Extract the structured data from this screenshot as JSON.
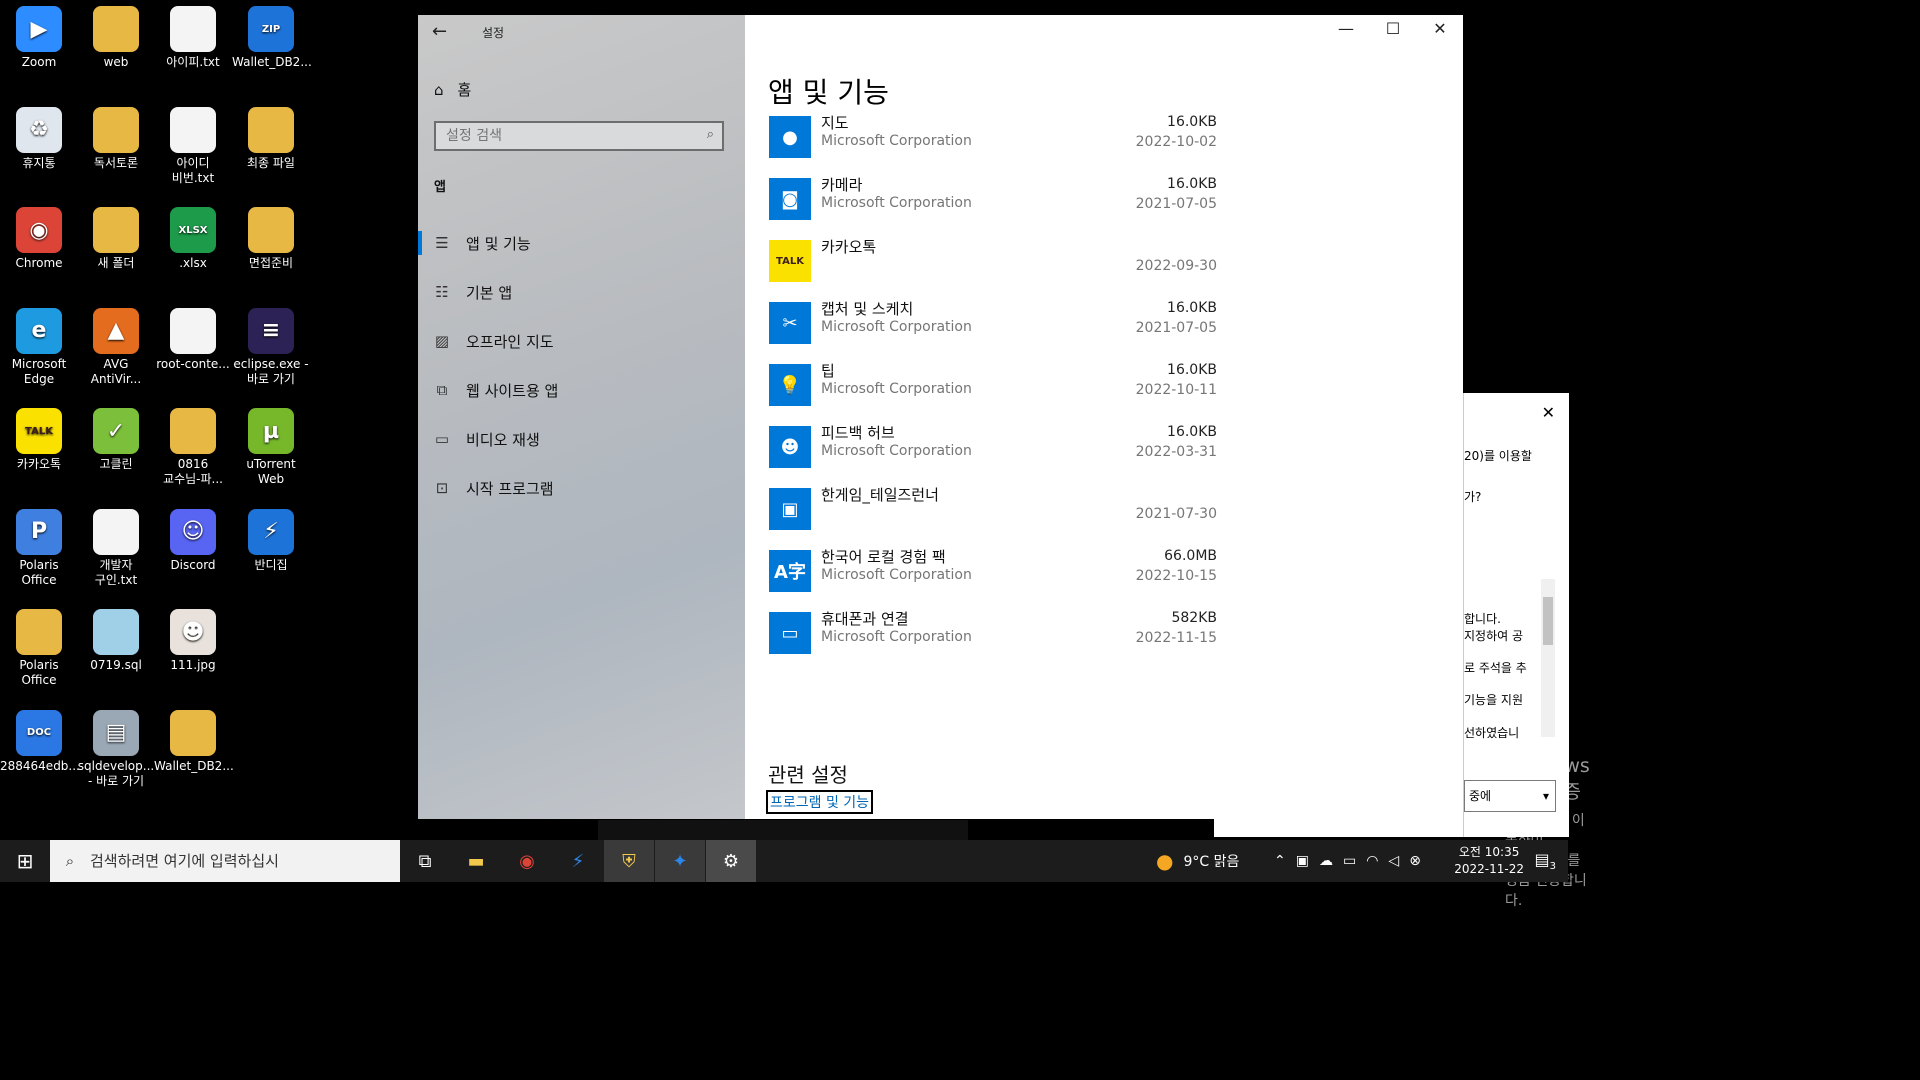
{
  "desktop": {
    "icons": [
      {
        "label": "Zoom",
        "icon": "zoom-icon",
        "color": "#2d8cff",
        "glyph": "▶"
      },
      {
        "label": "web",
        "icon": "folder-icon",
        "color": "#e8b844",
        "glyph": ""
      },
      {
        "label": "아이피.txt",
        "icon": "text-file-icon",
        "color": "#f4f4f4",
        "glyph": ""
      },
      {
        "label": "Wallet_DB2...",
        "icon": "zip-icon",
        "color": "#1e73d8",
        "glyph": "ZIP"
      },
      {
        "label": "휴지통",
        "icon": "recycle-bin-icon",
        "color": "#dfe6ee",
        "glyph": "♻"
      },
      {
        "label": "독서토론",
        "icon": "folder-icon",
        "color": "#e8b844",
        "glyph": ""
      },
      {
        "label": "아이디\n비번.txt",
        "icon": "text-file-icon",
        "color": "#f4f4f4",
        "glyph": ""
      },
      {
        "label": "최종 파일",
        "icon": "folder-icon",
        "color": "#e8b844",
        "glyph": ""
      },
      {
        "label": "Chrome",
        "icon": "chrome-icon",
        "color": "#db4437",
        "glyph": "◉"
      },
      {
        "label": "새 폴더",
        "icon": "folder-icon",
        "color": "#e8b844",
        "glyph": ""
      },
      {
        "label": ".xlsx",
        "icon": "excel-file-icon",
        "color": "#1d9a4a",
        "glyph": "XLSX"
      },
      {
        "label": "면접준비",
        "icon": "folder-icon",
        "color": "#e8b844",
        "glyph": ""
      },
      {
        "label": "Microsoft\nEdge",
        "icon": "edge-icon",
        "color": "#1e9be0",
        "glyph": "e"
      },
      {
        "label": "AVG\nAntiVir...",
        "icon": "avg-icon",
        "color": "#e46c1e",
        "glyph": "▲"
      },
      {
        "label": "root-conte...",
        "icon": "text-file-icon",
        "color": "#f4f4f4",
        "glyph": ""
      },
      {
        "label": "eclipse.exe -\n바로 가기",
        "icon": "eclipse-icon",
        "color": "#2c2255",
        "glyph": "≡"
      },
      {
        "label": "카카오톡",
        "icon": "kakaotalk-icon",
        "color": "#fae100",
        "glyph": "TALK"
      },
      {
        "label": "고클린",
        "icon": "goclean-icon",
        "color": "#7bbf3a",
        "glyph": "✓"
      },
      {
        "label": "0816\n교수님-파...",
        "icon": "folder-icon",
        "color": "#e8b844",
        "glyph": ""
      },
      {
        "label": "uTorrent\nWeb",
        "icon": "utorrent-icon",
        "color": "#76b82a",
        "glyph": "µ"
      },
      {
        "label": "Polaris Office",
        "icon": "polaris-office-icon",
        "color": "#3f7fe0",
        "glyph": "P"
      },
      {
        "label": "개발자\n구인.txt",
        "icon": "text-file-icon",
        "color": "#f4f4f4",
        "glyph": ""
      },
      {
        "label": "Discord",
        "icon": "discord-icon",
        "color": "#5865f2",
        "glyph": "☺"
      },
      {
        "label": "반디집",
        "icon": "bandizip-icon",
        "color": "#1e73d8",
        "glyph": "⚡"
      },
      {
        "label": "Polaris Office",
        "icon": "folder-icon",
        "color": "#e8b844",
        "glyph": ""
      },
      {
        "label": "0719.sql",
        "icon": "sql-file-icon",
        "color": "#9fd0e8",
        "glyph": ""
      },
      {
        "label": "111.jpg",
        "icon": "photo-icon",
        "color": "#e9e2dc",
        "glyph": "☻"
      },
      {
        "label": "",
        "icon": "",
        "color": "",
        "glyph": ""
      },
      {
        "label": "288464edb...",
        "icon": "doc-file-icon",
        "color": "#2b78e4",
        "glyph": "DOC"
      },
      {
        "label": "sqldevelop...\n- 바로 가기",
        "icon": "sqldeveloper-icon",
        "color": "#9aa8b6",
        "glyph": "▤"
      },
      {
        "label": "Wallet_DB2...",
        "icon": "folder-icon",
        "color": "#e8b844",
        "glyph": ""
      }
    ]
  },
  "settings": {
    "window_title": "설정",
    "home_label": "홈",
    "search_placeholder": "설정 검색",
    "section_label": "앱",
    "nav_items": [
      {
        "label": "앱 및 기능",
        "icon": "apps-features-icon",
        "glyph": "☰"
      },
      {
        "label": "기본 앱",
        "icon": "default-apps-icon",
        "glyph": "☷"
      },
      {
        "label": "오프라인 지도",
        "icon": "offline-maps-icon",
        "glyph": "▨"
      },
      {
        "label": "웹 사이트용 앱",
        "icon": "apps-for-websites-icon",
        "glyph": "⧉"
      },
      {
        "label": "비디오 재생",
        "icon": "video-playback-icon",
        "glyph": "▭"
      },
      {
        "label": "시작 프로그램",
        "icon": "startup-icon",
        "glyph": "⊡"
      }
    ],
    "heading": "앱 및 기능",
    "apps": [
      {
        "name": "지도",
        "publisher": "Microsoft Corporation",
        "size": "16.0KB",
        "date": "2022-10-02",
        "icon": "maps-icon",
        "color": "#0078d7",
        "glyph": "●"
      },
      {
        "name": "카메라",
        "publisher": "Microsoft Corporation",
        "size": "16.0KB",
        "date": "2021-07-05",
        "icon": "camera-icon",
        "color": "#0078d7",
        "glyph": "◙"
      },
      {
        "name": "카카오톡",
        "publisher": "",
        "size": "",
        "date": "2022-09-30",
        "icon": "kakaotalk-icon",
        "color": "#fae100",
        "glyph": "TALK"
      },
      {
        "name": "캡처 및 스케치",
        "publisher": "Microsoft Corporation",
        "size": "16.0KB",
        "date": "2021-07-05",
        "icon": "snip-sketch-icon",
        "color": "#0078d7",
        "glyph": "✂"
      },
      {
        "name": "팁",
        "publisher": "Microsoft Corporation",
        "size": "16.0KB",
        "date": "2022-10-11",
        "icon": "tips-icon",
        "color": "#0078d7",
        "glyph": "💡"
      },
      {
        "name": "피드백 허브",
        "publisher": "Microsoft Corporation",
        "size": "16.0KB",
        "date": "2022-03-31",
        "icon": "feedback-hub-icon",
        "color": "#0078d7",
        "glyph": "☻"
      },
      {
        "name": "한게임_테일즈런너",
        "publisher": "",
        "size": "",
        "date": "2021-07-30",
        "icon": "talesrunner-icon",
        "color": "#0078d7",
        "glyph": "▣"
      },
      {
        "name": "한국어 로컬 경험 팩",
        "publisher": "Microsoft Corporation",
        "size": "66.0MB",
        "date": "2022-10-15",
        "icon": "language-pack-icon",
        "color": "#0078d7",
        "glyph": "A字"
      },
      {
        "name": "휴대폰과 연결",
        "publisher": "Microsoft Corporation",
        "size": "582KB",
        "date": "2022-11-15",
        "icon": "phone-link-icon",
        "color": "#0078d7",
        "glyph": "▭"
      }
    ],
    "related_heading": "관련 설정",
    "related_link": "프로그램 및 기능",
    "activation_title": "Windows 정품 인증",
    "activation_sub": "[설정]으로 이동하여 Windows를 정품 인증합니다."
  },
  "side_window": {
    "lines": [
      "20)를 이용할",
      "가?",
      "합니다.",
      "지정하여 공",
      "로 주석을 추",
      "기능을 지원",
      "선하였습니"
    ],
    "combo_value": "중에"
  },
  "taskbar": {
    "search_placeholder": "검색하려면 여기에 입력하십시",
    "weather": "9°C  맑음",
    "time": "오전 10:35",
    "date": "2022-11-22",
    "notification_count": "3"
  }
}
